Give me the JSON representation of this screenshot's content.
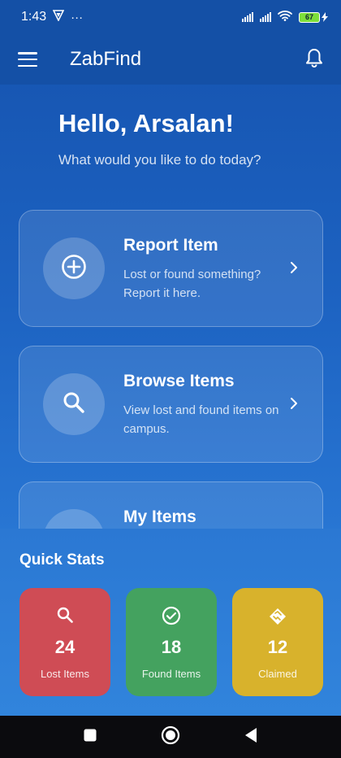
{
  "status_bar": {
    "time": "1:43",
    "dots": "···",
    "battery": "67"
  },
  "app_bar": {
    "title": "ZabFind"
  },
  "greeting": {
    "title": "Hello, Arsalan!",
    "subtitle": "What would you like to do today?"
  },
  "actions": [
    {
      "title": "Report Item",
      "desc": "Lost or found something? Report it here.",
      "icon": "plus-circle-icon"
    },
    {
      "title": "Browse Items",
      "desc": "View lost and found items on campus.",
      "icon": "search-icon"
    },
    {
      "title": "My Items",
      "desc": "",
      "icon": "list-icon"
    }
  ],
  "quick_stats": {
    "title": "Quick Stats",
    "items": [
      {
        "value": "24",
        "label": "Lost Items",
        "icon": "search-icon",
        "color": "#cf4c55"
      },
      {
        "value": "18",
        "label": "Found Items",
        "icon": "check-circle-icon",
        "color": "#44a25f"
      },
      {
        "value": "12",
        "label": "Claimed",
        "icon": "handshake-icon",
        "color": "#d8b22c"
      }
    ]
  },
  "colors": {
    "header": "#1450a6",
    "background": "#1d63c2",
    "nav_bar": "#0b0b0e"
  }
}
